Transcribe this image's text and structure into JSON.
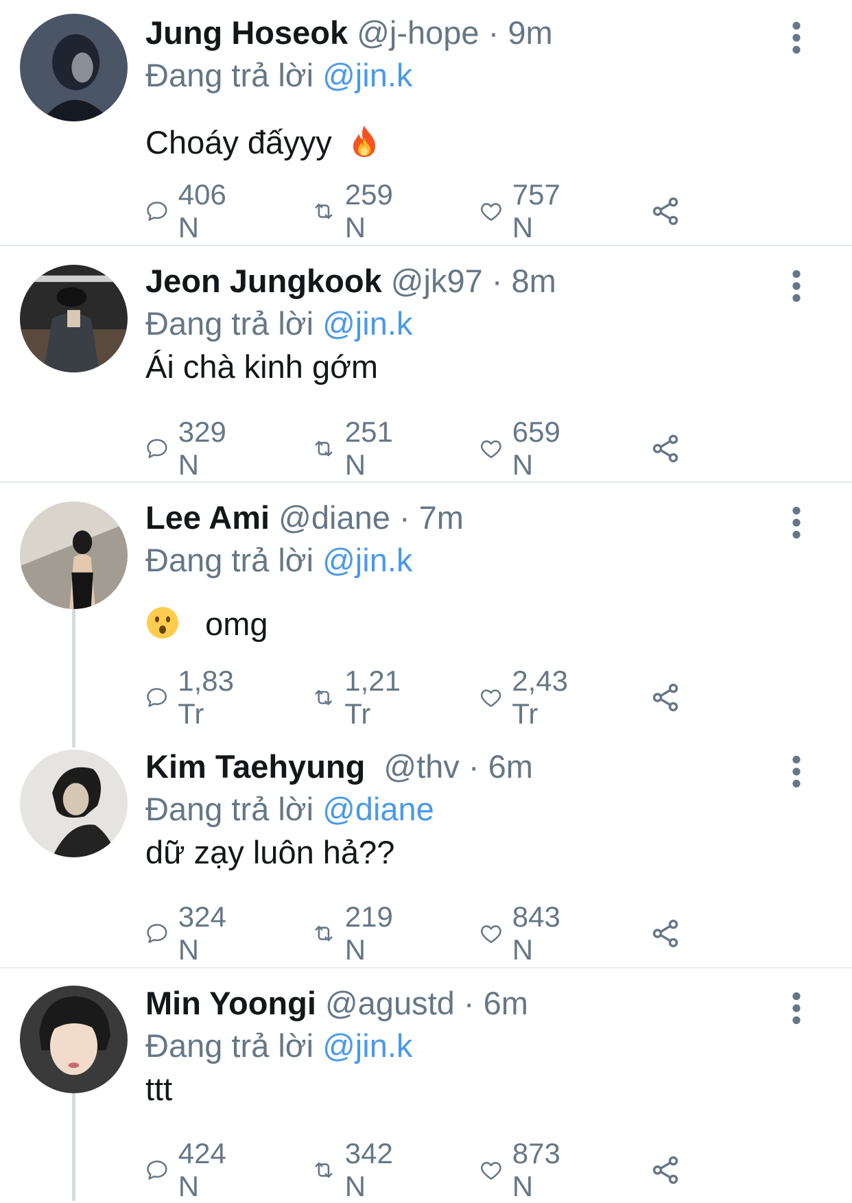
{
  "reply_prefix": "Đang trả lời",
  "tweets": [
    {
      "name": "Jung Hoseok",
      "handle": "@j-hope",
      "sep": "·",
      "time": "9m",
      "reply_to": "@jin.k",
      "text": "Choáy đấyyy",
      "emoji": "fire",
      "replies": "406 N",
      "retweets": "259 N",
      "likes": "757 N"
    },
    {
      "name": "Jeon Jungkook",
      "handle": "@jk97",
      "sep": "·",
      "time": "8m",
      "reply_to": "@jin.k",
      "text": "Ái chà kinh gớm",
      "replies": "329 N",
      "retweets": "251 N",
      "likes": "659 N"
    },
    {
      "name": "Lee Ami",
      "handle": "@diane",
      "sep": "·",
      "time": "7m",
      "reply_to": "@jin.k",
      "text": "omg",
      "emoji": "astonished-face",
      "replies": "1,83 Tr",
      "retweets": "1,21 Tr",
      "likes": "2,43 Tr"
    },
    {
      "name": "Kim Taehyung",
      "handle": "@thv",
      "sep": "·",
      "time": "6m",
      "reply_to": "@diane",
      "text": "dữ zạy luôn hả??",
      "replies": "324 N",
      "retweets": "219 N",
      "likes": "843 N"
    },
    {
      "name": "Min Yoongi",
      "handle": "@agustd",
      "sep": "·",
      "time": "6m",
      "reply_to": "@jin.k",
      "text": "ttt",
      "replies": "424 N",
      "retweets": "342 N",
      "likes": "873 N"
    }
  ],
  "icons": {
    "reply": "reply-icon",
    "retweet": "retweet-icon",
    "like": "heart-icon",
    "share": "share-icon",
    "more": "more-options-icon"
  },
  "colors": {
    "text": "#14171a",
    "secondary": "#657786",
    "link": "#4a99e9",
    "divider": "#e6ecf0",
    "thread_line": "#d3dbe1"
  }
}
